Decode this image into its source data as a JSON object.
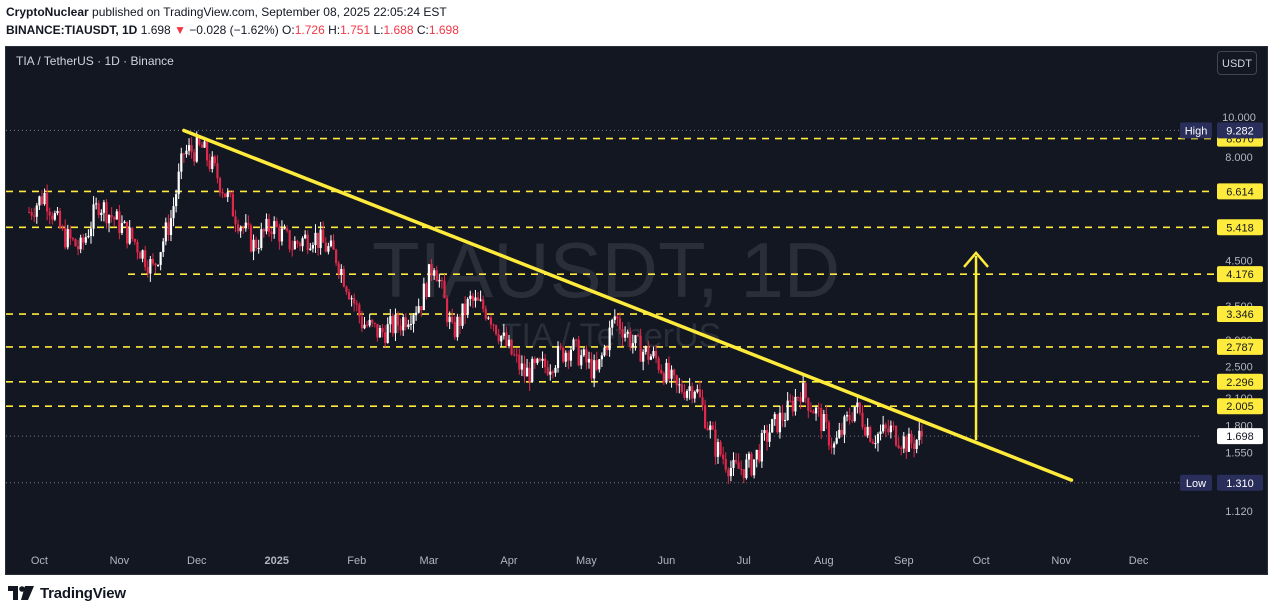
{
  "header": {
    "author": "CryptoNuclear",
    "published": "published on TradingView.com, September 08, 2025 22:05:24 EST",
    "symbol": "BINANCE:TIAUSDT, 1D",
    "last": "1.698",
    "arrow": "▼",
    "change": "−0.028 (−1.62%)",
    "o_label": "O:",
    "o_val": "1.726",
    "h_label": "H:",
    "h_val": "1.751",
    "l_label": "L:",
    "l_val": "1.688",
    "c_label": "C:",
    "c_val": "1.698"
  },
  "legend": "TIA / TetherUS · 1D · Binance",
  "currency_button": "USDT",
  "watermark": {
    "main": "TIAUSDT, 1D",
    "sub": "TIA / TetherUS"
  },
  "footer": {
    "brand": "TradingView"
  },
  "colors": {
    "background": "#131722",
    "up": "#ffffff",
    "down": "#e0294a",
    "level_line": "#ffeb3b",
    "trendline": "#ffeb3b",
    "high_badge": "#2a2e5a",
    "price_badge": "#ffffff"
  },
  "chart_data": {
    "type": "candlestick",
    "scale": "log",
    "x_ticks": [
      "Oct",
      "Nov",
      "Dec",
      "2025",
      "Feb",
      "Mar",
      "Apr",
      "May",
      "Jun",
      "Jul",
      "Aug",
      "Sep",
      "Oct",
      "Nov",
      "Dec"
    ],
    "y_ticks": [
      "10.000",
      "8.000",
      "4.500",
      "3.500",
      "2.900",
      "2.500",
      "2.100",
      "1.800",
      "1.550",
      "1.120"
    ],
    "y_tick_values": [
      10.0,
      8.0,
      4.5,
      3.5,
      2.9,
      2.5,
      2.1,
      1.8,
      1.55,
      1.12
    ],
    "levels": [
      {
        "label": "8.870",
        "value": 8.87
      },
      {
        "label": "6.614",
        "value": 6.614
      },
      {
        "label": "5.418",
        "value": 5.418
      },
      {
        "label": "4.176",
        "value": 4.176
      },
      {
        "label": "3.346",
        "value": 3.346
      },
      {
        "label": "2.787",
        "value": 2.787
      },
      {
        "label": "2.296",
        "value": 2.296
      },
      {
        "label": "2.005",
        "value": 2.005
      }
    ],
    "high": {
      "label": "High",
      "value_text": "9.282",
      "value": 9.282
    },
    "low": {
      "label": "Low",
      "value_text": "1.310",
      "value": 1.31
    },
    "last_price": {
      "value_text": "1.698",
      "value": 1.698
    },
    "trendline": {
      "start": {
        "date": "2024-11-26",
        "value": 9.28
      },
      "end": {
        "date": "2025-11-05",
        "value": 1.33
      }
    },
    "target_arrow": {
      "date": "2025-09-29",
      "from": 1.66,
      "to": 4.7
    },
    "ohlc_anchors": [
      {
        "date": "2024-09-27",
        "close": 5.9
      },
      {
        "date": "2024-10-03",
        "close": 6.5
      },
      {
        "date": "2024-10-10",
        "close": 5.2
      },
      {
        "date": "2024-10-17",
        "close": 4.8
      },
      {
        "date": "2024-10-24",
        "close": 6.2
      },
      {
        "date": "2024-10-31",
        "close": 5.6
      },
      {
        "date": "2024-11-07",
        "close": 5.0
      },
      {
        "date": "2024-11-14",
        "close": 4.3
      },
      {
        "date": "2024-11-21",
        "close": 5.7
      },
      {
        "date": "2024-11-26",
        "close": 8.2
      },
      {
        "date": "2024-12-03",
        "close": 8.4
      },
      {
        "date": "2024-12-09",
        "close": 7.2
      },
      {
        "date": "2024-12-16",
        "close": 5.8
      },
      {
        "date": "2024-12-23",
        "close": 4.9
      },
      {
        "date": "2024-12-30",
        "close": 5.5
      },
      {
        "date": "2025-01-07",
        "close": 4.9
      },
      {
        "date": "2025-01-15",
        "close": 5.2
      },
      {
        "date": "2025-01-24",
        "close": 4.6
      },
      {
        "date": "2025-02-03",
        "close": 3.2
      },
      {
        "date": "2025-02-10",
        "close": 3.0
      },
      {
        "date": "2025-02-18",
        "close": 3.2
      },
      {
        "date": "2025-02-26",
        "close": 3.6
      },
      {
        "date": "2025-03-03",
        "close": 4.5
      },
      {
        "date": "2025-03-10",
        "close": 3.0
      },
      {
        "date": "2025-03-17",
        "close": 3.6
      },
      {
        "date": "2025-03-24",
        "close": 3.4
      },
      {
        "date": "2025-03-31",
        "close": 2.8
      },
      {
        "date": "2025-04-07",
        "close": 2.4
      },
      {
        "date": "2025-04-15",
        "close": 2.5
      },
      {
        "date": "2025-04-25",
        "close": 2.8
      },
      {
        "date": "2025-05-05",
        "close": 2.4
      },
      {
        "date": "2025-05-12",
        "close": 3.3
      },
      {
        "date": "2025-05-20",
        "close": 2.8
      },
      {
        "date": "2025-05-28",
        "close": 2.6
      },
      {
        "date": "2025-06-05",
        "close": 2.2
      },
      {
        "date": "2025-06-12",
        "close": 2.25
      },
      {
        "date": "2025-06-20",
        "close": 1.6
      },
      {
        "date": "2025-06-27",
        "close": 1.4
      },
      {
        "date": "2025-07-04",
        "close": 1.45
      },
      {
        "date": "2025-07-11",
        "close": 1.75
      },
      {
        "date": "2025-07-18",
        "close": 1.95
      },
      {
        "date": "2025-07-23",
        "close": 2.2
      },
      {
        "date": "2025-07-30",
        "close": 1.9
      },
      {
        "date": "2025-08-05",
        "close": 1.6
      },
      {
        "date": "2025-08-13",
        "close": 2.0
      },
      {
        "date": "2025-08-20",
        "close": 1.7
      },
      {
        "date": "2025-08-27",
        "close": 1.75
      },
      {
        "date": "2025-09-03",
        "close": 1.62
      },
      {
        "date": "2025-09-08",
        "close": 1.698
      }
    ]
  }
}
